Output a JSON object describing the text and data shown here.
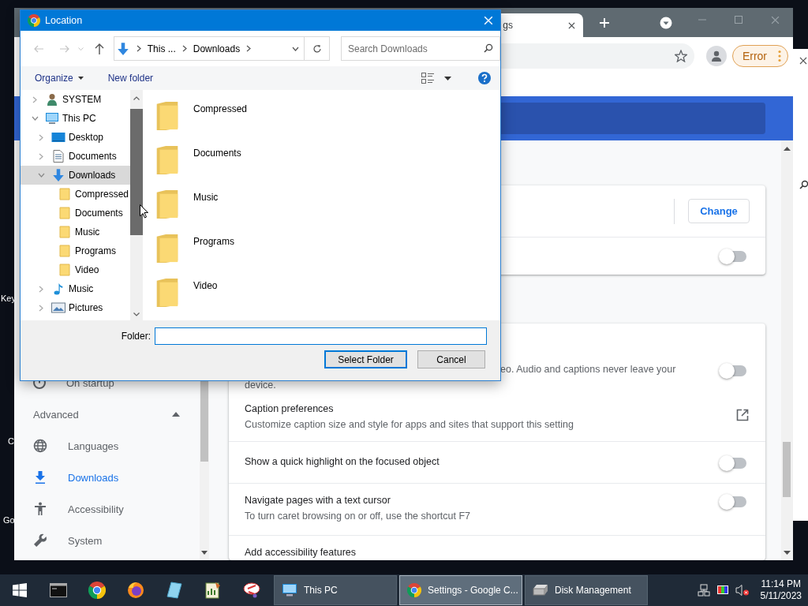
{
  "desktop": {
    "icon_labels": [
      "Key",
      "C",
      "Go"
    ]
  },
  "browser": {
    "tab": {
      "title": "gs"
    },
    "error_button": "Error",
    "sidebar": {
      "items": [
        {
          "label": "On startup",
          "selected": false
        }
      ],
      "advanced": {
        "label": "Advanced",
        "expanded": true,
        "items": [
          {
            "label": "Languages",
            "selected": false
          },
          {
            "label": "Downloads",
            "selected": true
          },
          {
            "label": "Accessibility",
            "selected": false
          },
          {
            "label": "System",
            "selected": false
          }
        ]
      }
    },
    "location_card": {
      "button": "Change",
      "toggle": {
        "on": false
      }
    },
    "accessibility_card": {
      "rows": [
        {
          "kind": "toggle",
          "description_lines": [
            "eo. Audio and captions never leave your",
            "device."
          ],
          "on": false
        },
        {
          "kind": "link",
          "title": "Caption preferences",
          "description": "Customize caption size and style for apps and sites that support this setting"
        },
        {
          "kind": "toggle",
          "title": "Show a quick highlight on the focused object",
          "on": false
        },
        {
          "kind": "toggle",
          "title": "Navigate pages with a text cursor",
          "description": "To turn caret browsing on or off, use the shortcut F7",
          "on": false
        },
        {
          "kind": "text",
          "title": "Add accessibility features"
        }
      ]
    }
  },
  "dialog": {
    "title": "Location",
    "address": {
      "crumbs": [
        "This ...",
        "Downloads"
      ]
    },
    "search": {
      "placeholder": "Search Downloads"
    },
    "commands": {
      "organize": "Organize",
      "new_folder": "New folder"
    },
    "tree": [
      {
        "label": "SYSTEM",
        "kind": "user",
        "expanded": false,
        "selected": false
      },
      {
        "label": "This PC",
        "kind": "pc",
        "expanded": true,
        "selected": false,
        "children": [
          {
            "label": "Desktop",
            "kind": "desktop",
            "expanded": false,
            "selected": false
          },
          {
            "label": "Documents",
            "kind": "documents",
            "expanded": false,
            "selected": false
          },
          {
            "label": "Downloads",
            "kind": "downloads",
            "expanded": true,
            "selected": true,
            "children": [
              {
                "label": "Compressed",
                "kind": "folder",
                "selected": false
              },
              {
                "label": "Documents",
                "kind": "folder",
                "selected": false
              },
              {
                "label": "Music",
                "kind": "folder",
                "selected": false
              },
              {
                "label": "Programs",
                "kind": "folder",
                "selected": false
              },
              {
                "label": "Video",
                "kind": "folder",
                "selected": false
              }
            ]
          },
          {
            "label": "Music",
            "kind": "music",
            "expanded": false,
            "selected": false
          },
          {
            "label": "Pictures",
            "kind": "pictures",
            "expanded": false,
            "selected": false
          }
        ]
      }
    ],
    "folders": [
      "Compressed",
      "Documents",
      "Music",
      "Programs",
      "Video"
    ],
    "folder_label": "Folder:",
    "buttons": [
      {
        "label": "Select Folder",
        "default": true
      },
      {
        "label": "Cancel",
        "default": false
      }
    ]
  },
  "taskbar": {
    "windows": [
      {
        "label": "This PC",
        "selected": false
      },
      {
        "label": "Settings - Google C...",
        "selected": true
      },
      {
        "label": "Disk Management",
        "selected": false
      }
    ],
    "clock": {
      "time": "11:14 PM",
      "date": "5/11/2023"
    }
  }
}
